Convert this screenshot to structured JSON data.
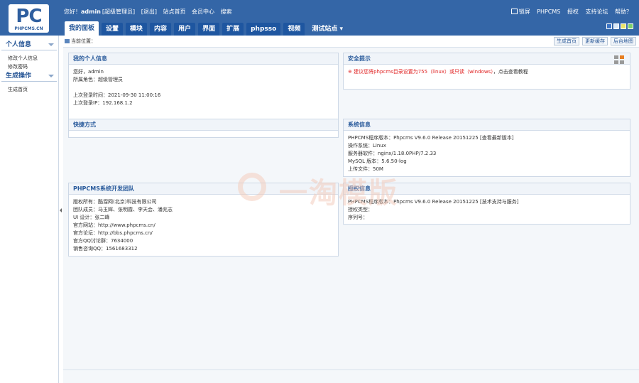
{
  "logo": {
    "main": "PC",
    "sub": "PHPCMS.CN"
  },
  "header": {
    "greeting": "您好！",
    "username": "admin",
    "role": "[超级管理员]",
    "logout": "[退出]",
    "links": [
      "站点首页",
      "会员中心",
      "搜索"
    ],
    "right_links": [
      "锁屏",
      "PHPCMS",
      "授权",
      "支持论坛",
      "帮助？"
    ]
  },
  "nav": {
    "tabs": [
      "我的面板",
      "设置",
      "模块",
      "内容",
      "用户",
      "界面",
      "扩展",
      "phpsso",
      "视频"
    ],
    "site_selector": "测试站点"
  },
  "sidebar": {
    "section1": "个人信息",
    "section1_items": [
      "修改个人信息",
      "修改密码"
    ],
    "section2": "生成操作",
    "section2_items": [
      "生成首页"
    ]
  },
  "crumb": {
    "label": "当前位置：",
    "buttons": [
      "生成首页",
      "更新缓存",
      "后台地图"
    ]
  },
  "panels": {
    "myinfo": {
      "title": "我的个人信息",
      "hello": "您好，admin",
      "role": "所属角色：超级管理员",
      "last_time": "上次登录时间：2021-09-30 11:00:16",
      "last_ip": "上次登录IP：192.168.1.2"
    },
    "security": {
      "title": "安全提示",
      "warning": "※ 建议您将phpcms目录设置为755（linux）或只读（windows）",
      "link": "，点击查看教程"
    },
    "shortcuts": {
      "title": "快捷方式"
    },
    "sysinfo": {
      "title": "系统信息",
      "lines": [
        "PHPCMS程序版本：Phpcms V9.6.0 Release 20151225 [查看最新版本]",
        "操作系统：Linux",
        "服务器软件：nginx/1.18.0PHP/7.2.33",
        "MySQL 版本：5.6.50-log",
        "上传文件：50M"
      ]
    },
    "team": {
      "title": "PHPCMS系统开发团队",
      "lines": [
        "版权所有：酷溜网(北京)科技有限公司",
        "团队成员：马玉辉、张明霞、李天会、潘兆志",
        "UI 设计：张二峰",
        "官方网站：http://www.phpcms.cn/",
        "官方论坛：http://bbs.phpcms.cn/",
        "官方QQ讨论群：7634000",
        "销售咨询QQ：1561683312"
      ]
    },
    "license": {
      "title": "授权信息",
      "lines": [
        "PHPCMS程序版本：Phpcms V9.6.0 Release 20151225 [技术支持与服务]",
        "授权类型：",
        "序列号："
      ]
    }
  },
  "watermark": "一淘模版",
  "colors": {
    "header_bg": "#3466a7",
    "tab_bg": "#1e56a0",
    "warning": "#e02222"
  }
}
